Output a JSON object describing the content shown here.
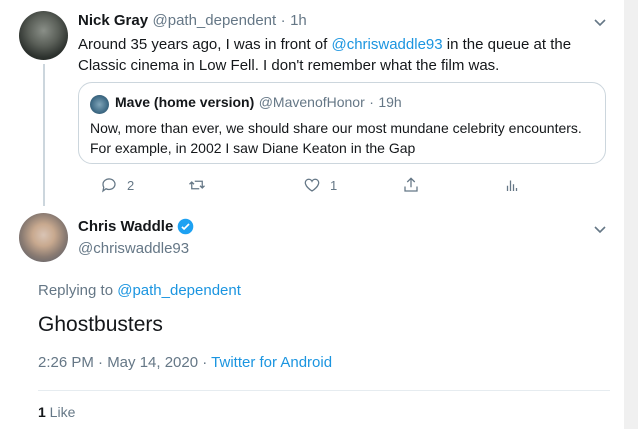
{
  "parent_tweet": {
    "name": "Nick Gray",
    "handle": "@path_dependent",
    "time_sep": "·",
    "time": "1h",
    "text_before": "Around 35 years ago, I was in front of ",
    "mention": "@chriswaddle93",
    "text_after": " in the queue at the Classic cinema in Low Fell. I don't remember what the film was.",
    "quoted": {
      "name": "Mave (home version)",
      "handle": "@MavenofHonor",
      "time_sep": "·",
      "time": "19h",
      "text": "Now, more than ever, we should share our most mundane celebrity encounters. For example, in 2002 I saw Diane Keaton in the Gap"
    },
    "actions": {
      "reply_count": "2",
      "like_count": "1"
    }
  },
  "reply_tweet": {
    "name": "Chris Waddle",
    "handle": "@chriswaddle93",
    "replying_prefix": "Replying to ",
    "replying_handle": "@path_dependent",
    "text": "Ghostbusters",
    "timestamp": "2:26 PM · May 14, 2020 · ",
    "client": "Twitter for Android",
    "likes_count": "1",
    "likes_label": " Like"
  },
  "colors": {
    "accent": "#1b95e0",
    "muted": "#657786",
    "text": "#14171a",
    "border": "#ccd6dd"
  },
  "icons": [
    "chevron-down-icon",
    "reply-icon",
    "retweet-icon",
    "heart-icon",
    "share-icon",
    "analytics-icon",
    "verified-badge-icon"
  ]
}
